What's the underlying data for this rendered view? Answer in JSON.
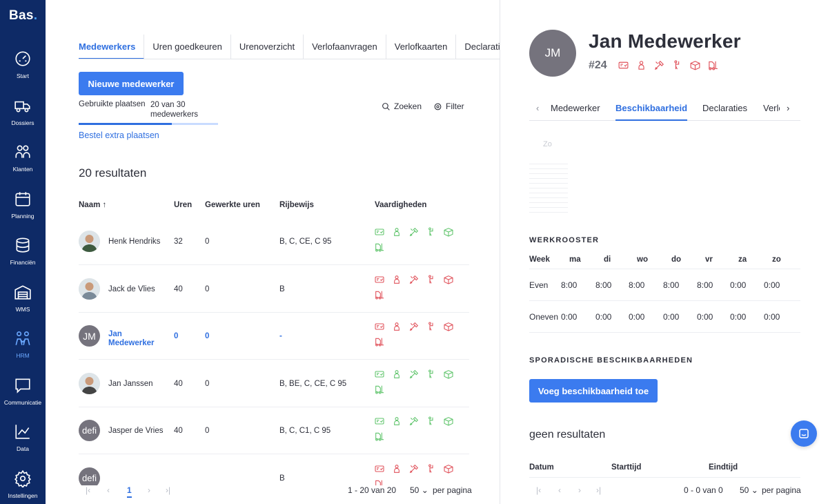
{
  "brand": {
    "name": "Bas",
    "dot": "."
  },
  "sidebar": {
    "items": [
      {
        "label": "Start",
        "icon": "speedometer-icon"
      },
      {
        "label": "Dossiers",
        "icon": "truck-icon"
      },
      {
        "label": "Klanten",
        "icon": "people-icon"
      },
      {
        "label": "Planning",
        "icon": "calendar-icon"
      },
      {
        "label": "Financiën",
        "icon": "coins-icon"
      },
      {
        "label": "WMS",
        "icon": "warehouse-icon"
      },
      {
        "label": "HRM",
        "icon": "team-icon",
        "active": true
      },
      {
        "label": "Communicatie",
        "icon": "chat-icon"
      },
      {
        "label": "Data",
        "icon": "chart-icon"
      },
      {
        "label": "Instellingen",
        "icon": "gear-icon"
      }
    ]
  },
  "tabs": [
    "Medewerkers",
    "Uren goedkeuren",
    "Urenoverzicht",
    "Verlofaanvragen",
    "Verlofkaarten",
    "Declaraties"
  ],
  "new_employee_button": "Nieuwe medewerker",
  "seats": {
    "label": "Gebruikte plaatsen",
    "count_line1": "20 van 30",
    "count_line2": "medewerkers",
    "used_fraction": 0.667
  },
  "order_link": "Bestel extra plaatsen",
  "toolbar": {
    "search": "Zoeken",
    "filter": "Filter"
  },
  "results_label": "20 resultaten",
  "table": {
    "headers": {
      "name": "Naam",
      "hours": "Uren",
      "worked": "Gewerkte uren",
      "license": "Rijbewijs",
      "skills": "Vaardigheden"
    },
    "rows": [
      {
        "name": "Henk Hendriks",
        "hours": "32",
        "worked": "0",
        "license": "B, C, CE, C 95",
        "avatar": "photo",
        "skill_color": "green"
      },
      {
        "name": "Jack de Vlies",
        "hours": "40",
        "worked": "0",
        "license": "B",
        "avatar": "photo",
        "skill_color": "red"
      },
      {
        "name": "Jan Medewerker",
        "hours": "0",
        "worked": "0",
        "license": "-",
        "avatar": "JM",
        "skill_color": "red",
        "selected": true
      },
      {
        "name": "Jan Janssen",
        "hours": "40",
        "worked": "0",
        "license": "B, BE, C, CE, C 95",
        "avatar": "photo",
        "skill_color": "green"
      },
      {
        "name": "Jasper de Vries",
        "hours": "40",
        "worked": "0",
        "license": "B, C, C1, C 95",
        "avatar": "defi",
        "skill_color": "green"
      },
      {
        "name": "",
        "hours": "",
        "worked": "",
        "license": "B",
        "avatar": "defi",
        "skill_color": "red"
      }
    ]
  },
  "pagination": {
    "page": "1",
    "range": "1 - 20 van 20",
    "per_page": "50",
    "per_page_label": "per pagina"
  },
  "colors": {
    "accent": "#3b7bef",
    "sidebar": "#0e2a66",
    "skill_red": "#e0515a",
    "skill_green": "#5fc46b"
  },
  "detail": {
    "initials": "JM",
    "name": "Jan Medewerker",
    "number": "#24",
    "tabs": [
      "Medewerker",
      "Beschikbaarheid",
      "Declaraties",
      "Verlo"
    ],
    "active_tab": "Beschikbaarheid",
    "zo_label": "Zo",
    "schedule": {
      "title": "WERKROOSTER",
      "headers": [
        "Week",
        "ma",
        "di",
        "wo",
        "do",
        "vr",
        "za",
        "zo"
      ],
      "rows": [
        {
          "week": "Even",
          "values": [
            "8:00",
            "8:00",
            "8:00",
            "8:00",
            "8:00",
            "0:00",
            "0:00"
          ]
        },
        {
          "week": "Oneven",
          "values": [
            "0:00",
            "0:00",
            "0:00",
            "0:00",
            "0:00",
            "0:00",
            "0:00"
          ]
        }
      ]
    },
    "sporadic": {
      "title": "SPORADISCHE BESCHIKBAARHEDEN",
      "add_button": "Voeg beschikbaarheid toe",
      "empty": "geen resultaten",
      "headers": [
        "Datum",
        "Starttijd",
        "Eindtijd"
      ]
    },
    "pagination": {
      "range": "0 - 0 van 0",
      "per_page": "50",
      "per_page_label": "per pagina"
    }
  }
}
